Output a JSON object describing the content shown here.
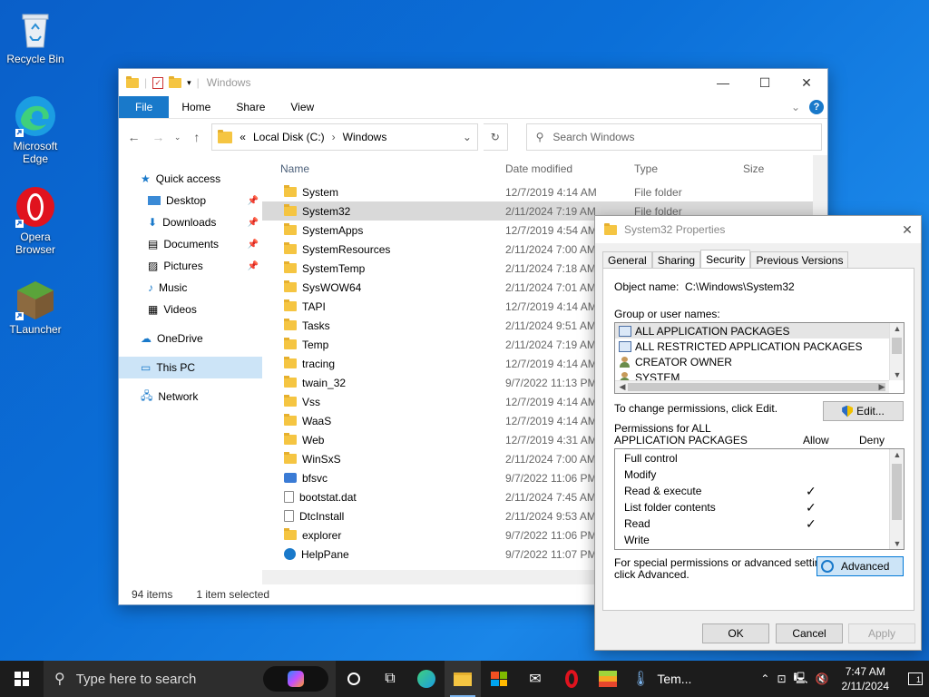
{
  "desktop": {
    "icons": [
      {
        "label": "Recycle Bin"
      },
      {
        "label": "Microsoft Edge"
      },
      {
        "label": "Opera Browser"
      },
      {
        "label": "TLauncher"
      }
    ]
  },
  "explorer": {
    "title": "Windows",
    "ribbon_tabs": [
      "File",
      "Home",
      "Share",
      "View"
    ],
    "help": "?",
    "address": {
      "prefix": "«",
      "parts": [
        "Local Disk (C:)",
        "Windows"
      ]
    },
    "search_placeholder": "Search Windows",
    "columns": [
      "Name",
      "Date modified",
      "Type",
      "Size"
    ],
    "nav": {
      "quick_access": "Quick access",
      "items": [
        "Desktop",
        "Downloads",
        "Documents",
        "Pictures",
        "Music",
        "Videos"
      ],
      "onedrive": "OneDrive",
      "this_pc": "This PC",
      "network": "Network"
    },
    "files": [
      {
        "name": "System",
        "date": "12/7/2019 4:14 AM",
        "type": "File folder",
        "kind": "folder"
      },
      {
        "name": "System32",
        "date": "2/11/2024 7:19 AM",
        "type": "File folder",
        "kind": "folder",
        "selected": true
      },
      {
        "name": "SystemApps",
        "date": "12/7/2019 4:54 AM",
        "type": "",
        "kind": "folder"
      },
      {
        "name": "SystemResources",
        "date": "2/11/2024 7:00 AM",
        "type": "",
        "kind": "folder"
      },
      {
        "name": "SystemTemp",
        "date": "2/11/2024 7:18 AM",
        "type": "",
        "kind": "folder"
      },
      {
        "name": "SysWOW64",
        "date": "2/11/2024 7:01 AM",
        "type": "",
        "kind": "folder"
      },
      {
        "name": "TAPI",
        "date": "12/7/2019 4:14 AM",
        "type": "",
        "kind": "folder"
      },
      {
        "name": "Tasks",
        "date": "2/11/2024 9:51 AM",
        "type": "",
        "kind": "folder"
      },
      {
        "name": "Temp",
        "date": "2/11/2024 7:19 AM",
        "type": "",
        "kind": "folder"
      },
      {
        "name": "tracing",
        "date": "12/7/2019 4:14 AM",
        "type": "",
        "kind": "folder"
      },
      {
        "name": "twain_32",
        "date": "9/7/2022 11:13 PM",
        "type": "",
        "kind": "folder"
      },
      {
        "name": "Vss",
        "date": "12/7/2019 4:14 AM",
        "type": "",
        "kind": "folder"
      },
      {
        "name": "WaaS",
        "date": "12/7/2019 4:14 AM",
        "type": "",
        "kind": "folder"
      },
      {
        "name": "Web",
        "date": "12/7/2019 4:31 AM",
        "type": "",
        "kind": "folder"
      },
      {
        "name": "WinSxS",
        "date": "2/11/2024 7:00 AM",
        "type": "",
        "kind": "folder"
      },
      {
        "name": "bfsvc",
        "date": "9/7/2022 11:06 PM",
        "type": "",
        "kind": "app"
      },
      {
        "name": "bootstat.dat",
        "date": "2/11/2024 7:45 AM",
        "type": "",
        "kind": "file"
      },
      {
        "name": "DtcInstall",
        "date": "2/11/2024 9:53 AM",
        "type": "",
        "kind": "file"
      },
      {
        "name": "explorer",
        "date": "9/7/2022 11:06 PM",
        "type": "",
        "kind": "folder"
      },
      {
        "name": "HelpPane",
        "date": "9/7/2022 11:07 PM",
        "type": "",
        "kind": "help"
      }
    ],
    "status": {
      "count": "94 items",
      "selection": "1 item selected"
    }
  },
  "dialog": {
    "title": "System32 Properties",
    "tabs": [
      "General",
      "Sharing",
      "Security",
      "Previous Versions"
    ],
    "active_tab": "Security",
    "object_name_label": "Object name:",
    "object_name_value": "C:\\Windows\\System32",
    "group_label": "Group or user names:",
    "groups": [
      {
        "name": "ALL APPLICATION PACKAGES",
        "icon": "package",
        "selected": true
      },
      {
        "name": "ALL RESTRICTED APPLICATION PACKAGES",
        "icon": "package"
      },
      {
        "name": "CREATOR OWNER",
        "icon": "user"
      },
      {
        "name": "SYSTEM",
        "icon": "user"
      }
    ],
    "change_text": "To change permissions, click Edit.",
    "edit_button": "Edit...",
    "perm_label_line1": "Permissions for ALL",
    "perm_label_line2": "APPLICATION PACKAGES",
    "allow_label": "Allow",
    "deny_label": "Deny",
    "permissions": [
      {
        "name": "Full control",
        "allow": false
      },
      {
        "name": "Modify",
        "allow": false
      },
      {
        "name": "Read & execute",
        "allow": true
      },
      {
        "name": "List folder contents",
        "allow": true
      },
      {
        "name": "Read",
        "allow": true
      },
      {
        "name": "Write",
        "allow": false
      }
    ],
    "check_glyph": "✓",
    "special_line1": "For special permissions or advanced settings,",
    "special_line2": "click Advanced.",
    "advanced_button": "Advanced",
    "ok_button": "OK",
    "cancel_button": "Cancel",
    "apply_button": "Apply"
  },
  "taskbar": {
    "search_placeholder": "Type here to search",
    "temp_label": "Tem...",
    "time": "7:47 AM",
    "date": "2/11/2024",
    "notification_count": "1"
  }
}
